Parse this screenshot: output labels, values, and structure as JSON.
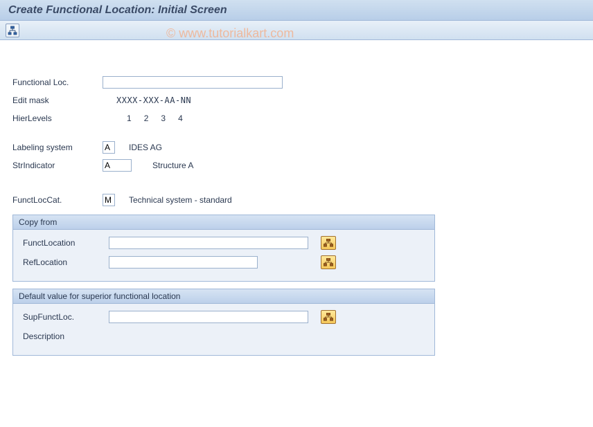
{
  "header": {
    "title": "Create Functional Location: Initial Screen"
  },
  "watermark": "© www.tutorialkart.com",
  "fields": {
    "funcloc_label": "Functional Loc.",
    "funcloc_value": "",
    "editmask_label": "Edit mask",
    "editmask_value": "XXXX-XXX-AA-NN",
    "hierlevels_label": "HierLevels",
    "hierlevels_values": [
      "1",
      "2",
      "3",
      "4"
    ],
    "labeling_label": "Labeling system",
    "labeling_value": "A",
    "labeling_text": "IDES AG",
    "strind_label": "StrIndicator",
    "strind_value": "A",
    "strind_text": "Structure A",
    "funcloccat_label": "FunctLocCat.",
    "funcloccat_value": "M",
    "funcloccat_text": "Technical system - standard"
  },
  "group_copy": {
    "title": "Copy from",
    "fl_label": "FunctLocation",
    "fl_value": "",
    "ref_label": "RefLocation",
    "ref_value": ""
  },
  "group_default": {
    "title": "Default value for superior functional location",
    "sup_label": "SupFunctLoc.",
    "sup_value": "",
    "desc_label": "Description",
    "desc_value": ""
  }
}
